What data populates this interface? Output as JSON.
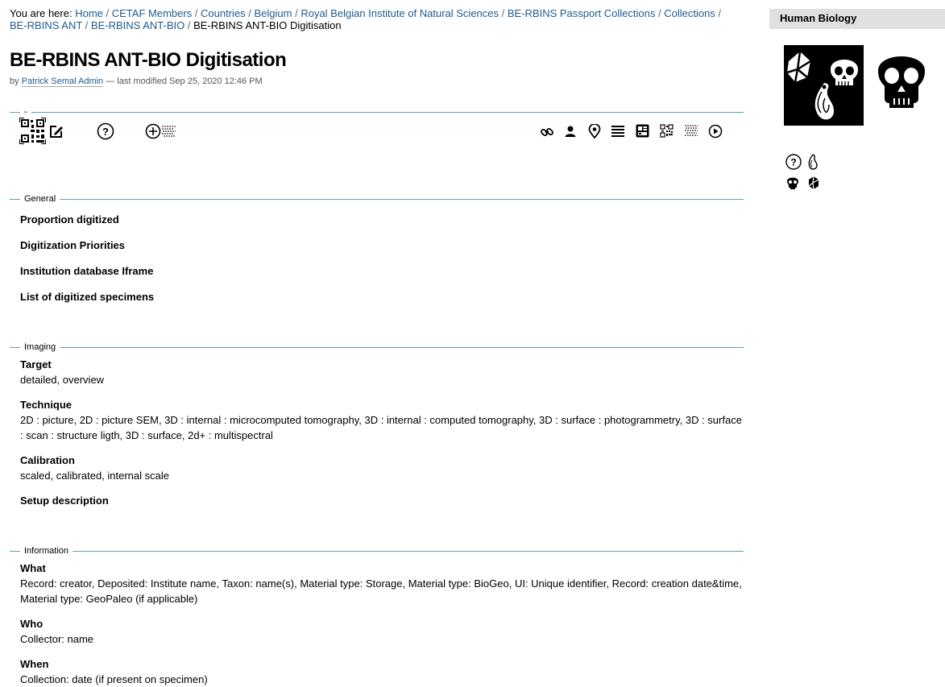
{
  "breadcrumb": {
    "prefix": "You are here:",
    "links": [
      "Home",
      "CETAF Members",
      "Countries",
      "Belgium",
      "Royal Belgian Institute of Natural Sciences",
      "BE-RBINS Passport Collections",
      "Collections",
      "BE-RBINS ANT",
      "BE-RBINS ANT-BIO"
    ],
    "current": "BE-RBINS ANT-BIO Digitisation"
  },
  "page": {
    "title": "BE-RBINS ANT-BIO Digitisation",
    "by": "by",
    "author": "Patrick Semal Admin",
    "modified": "— last modified Sep 25, 2020 12:46 PM"
  },
  "sections": {
    "top_legend": "-",
    "general": {
      "legend": "General",
      "fields": [
        "Proportion digitized",
        "Digitization Priorities",
        "Institution database Iframe",
        "List of digitized specimens"
      ]
    },
    "imaging": {
      "legend": "Imaging",
      "target_label": "Target",
      "target_value": "detailed, overview",
      "technique_label": "Technique",
      "technique_value": "2D : picture, 2D : picture SEM, 3D : internal : microcomputed tomography, 3D : internal : computed tomography, 3D : surface : photogrammetry, 3D : surface : scan : structure ligth, 3D : surface, 2d+ : multispectral",
      "calibration_label": "Calibration",
      "calibration_value": "scaled, calibrated, internal scale",
      "setup_label": "Setup description"
    },
    "information": {
      "legend": "Information",
      "what_label": "What",
      "what_value": "Record: creator, Deposited: Institute name, Taxon: name(s), Material type: Storage, Material type: BioGeo, UI: Unique identifier, Record: creation date&time, Material type: GeoPaleo (if applicable)",
      "who_label": "Who",
      "who_value": "Collector: name",
      "when_label": "When",
      "when_value": "Collection: date (if present on specimen)"
    }
  },
  "sidebar": {
    "title": "Human Biology"
  },
  "icons": {
    "left": [
      "qr-code-icon",
      "edit-icon",
      "help-icon",
      "add-map-icon"
    ],
    "right": [
      "link-icon",
      "person-icon",
      "location-pin-icon",
      "list-icon",
      "layout-icon",
      "qr-code-icon",
      "map-icon",
      "play-icon"
    ]
  }
}
